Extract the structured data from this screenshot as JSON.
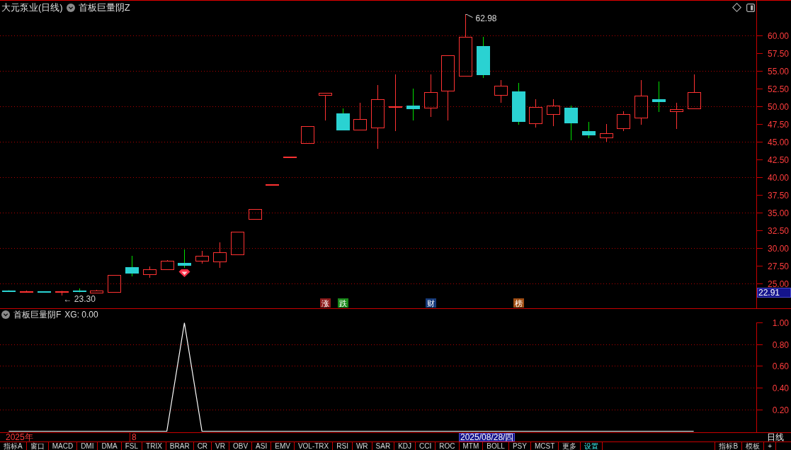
{
  "header": {
    "title": "大元泵业(日线)",
    "indicator": "首板巨量阴Z"
  },
  "price_chart": {
    "chart_data": {
      "type": "candlestick",
      "categories": [
        null,
        null,
        null,
        null,
        null,
        null,
        null,
        null,
        null,
        null,
        null,
        null,
        null,
        null,
        null,
        null,
        null,
        null,
        null,
        null,
        null,
        null,
        null,
        null,
        null,
        null,
        null,
        null,
        null,
        null,
        null,
        null,
        null,
        null,
        null,
        null,
        null,
        null,
        null,
        null
      ],
      "ylim": [
        21.5,
        64.9
      ],
      "grid": true,
      "yticks": [
        {
          "value": 60,
          "label": "60.00"
        },
        {
          "value": 57.5,
          "label": "57.50"
        },
        {
          "value": 55,
          "label": "55.00"
        },
        {
          "value": 52.5,
          "label": "52.50"
        },
        {
          "value": 50,
          "label": "50.00"
        },
        {
          "value": 47.5,
          "label": "47.50"
        },
        {
          "value": 45,
          "label": "45.00"
        },
        {
          "value": 42.5,
          "label": "42.50"
        },
        {
          "value": 40,
          "label": "40.00"
        },
        {
          "value": 37.5,
          "label": "37.50"
        },
        {
          "value": 35,
          "label": "35.00"
        },
        {
          "value": 32.5,
          "label": "32.50"
        },
        {
          "value": 30,
          "label": "30.00"
        },
        {
          "value": 27.5,
          "label": "27.50"
        },
        {
          "value": 25,
          "label": "25.00"
        }
      ],
      "annotations": [
        "62.98",
        "← 23.30"
      ]
    },
    "event_badges": [
      {
        "label": "涨",
        "color": "#8c1a1a"
      },
      {
        "label": "跌",
        "color": "#1a8a1a"
      },
      {
        "label": "财",
        "color": "#163a7a"
      },
      {
        "label": "榜",
        "color": "#a04e14"
      }
    ],
    "current_price_tag": "22.91"
  },
  "indicator_panel": {
    "name": "首板巨量阴F",
    "readout": "XG: 0.00",
    "chart_data": {
      "type": "line",
      "ylim": [
        -0.01,
        1.0
      ],
      "grid": true,
      "yticks": [
        {
          "value": 1,
          "label": "1.00"
        },
        {
          "value": 0.8,
          "label": "0.80"
        },
        {
          "value": 0.6,
          "label": "0.60"
        },
        {
          "value": 0.4,
          "label": "0.40"
        },
        {
          "value": 0.2,
          "label": "0.20"
        }
      ],
      "values": [
        0,
        0,
        0,
        0,
        0,
        0,
        0,
        0,
        0,
        0,
        1,
        0,
        0,
        0,
        0,
        0,
        0,
        0,
        0,
        0,
        0,
        0,
        0,
        0,
        0,
        0,
        0,
        0,
        0,
        0,
        0,
        0,
        0,
        0,
        0,
        0,
        0,
        0,
        0,
        0
      ]
    }
  },
  "time_axis": {
    "year": "2025年",
    "month": "8",
    "cursor_date": "2025/08/28/四",
    "period": "日线"
  },
  "indicator_tabs": [
    {
      "label": "指标A",
      "highlighted": false
    },
    {
      "label": "窗口",
      "highlighted": false
    },
    {
      "label": "MACD",
      "highlighted": false
    },
    {
      "label": "DMI",
      "highlighted": false
    },
    {
      "label": "DMA",
      "highlighted": false
    },
    {
      "label": "FSL",
      "highlighted": false
    },
    {
      "label": "TRIX",
      "highlighted": false
    },
    {
      "label": "BRAR",
      "highlighted": false
    },
    {
      "label": "CR",
      "highlighted": false
    },
    {
      "label": "VR",
      "highlighted": false
    },
    {
      "label": "OBV",
      "highlighted": false
    },
    {
      "label": "ASI",
      "highlighted": false
    },
    {
      "label": "EMV",
      "highlighted": false
    },
    {
      "label": "VOL-TRX",
      "highlighted": false
    },
    {
      "label": "RSI",
      "highlighted": false
    },
    {
      "label": "WR",
      "highlighted": false
    },
    {
      "label": "SAR",
      "highlighted": false
    },
    {
      "label": "KDJ",
      "highlighted": false
    },
    {
      "label": "CCI",
      "highlighted": false
    },
    {
      "label": "ROC",
      "highlighted": false
    },
    {
      "label": "MTM",
      "highlighted": false
    },
    {
      "label": "BOLL",
      "highlighted": false
    },
    {
      "label": "PSY",
      "highlighted": false
    },
    {
      "label": "MCST",
      "highlighted": false
    },
    {
      "label": "更多",
      "highlighted": false
    },
    {
      "label": "设置",
      "highlighted": true
    }
  ],
  "template_tabs": [
    {
      "label": "指标B"
    },
    {
      "label": "模板"
    },
    {
      "label": "+"
    }
  ]
}
